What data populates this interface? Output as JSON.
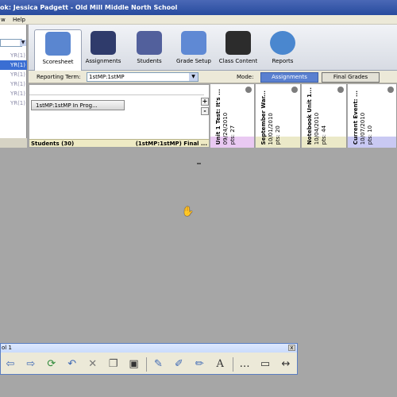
{
  "window": {
    "title": "ok: Jessica Padgett - Old Mill Middle North School"
  },
  "menu": [
    "w",
    "Help"
  ],
  "left_panel": {
    "rows": [
      "YR(1)",
      "YR(1)",
      "YR(1)",
      "YR(1)",
      "YR(1)",
      "YR(1)"
    ],
    "selected_index": 1
  },
  "ribbon_tabs": [
    {
      "label": "Scoresheet",
      "icon": "scoresheet-icon",
      "color": "#5a86d0",
      "active": true
    },
    {
      "label": "Assignments",
      "icon": "assignments-icon",
      "color": "#2f3b6b",
      "active": false
    },
    {
      "label": "Students",
      "icon": "students-icon",
      "color": "#52609c",
      "active": false
    },
    {
      "label": "Grade Setup",
      "icon": "grade-setup-icon",
      "color": "#5f89d4",
      "active": false
    },
    {
      "label": "Class Content",
      "icon": "class-content-icon",
      "color": "#2c2c2c",
      "active": false
    },
    {
      "label": "Reports",
      "icon": "reports-icon",
      "color": "#4a87cf",
      "active": false
    }
  ],
  "toolbar": {
    "reporting_term_label": "Reporting Term:",
    "reporting_term_value": "1stMP:1stMP",
    "mode_label": "Mode:",
    "mode_assignments": "Assignments",
    "mode_final_grades": "Final Grades"
  },
  "student_panel": {
    "group_button": "1stMP:1stMP In Prog...",
    "plus": "+",
    "minus": "-",
    "footer_left": "Students (30)",
    "footer_right": "(1stMP:1stMP) Final ..."
  },
  "assignments": [
    {
      "title": "Unit 1 Test: It's ...",
      "date": "09/24/2010",
      "pts": "pts: 27",
      "color": "#e9c9f2"
    },
    {
      "title": "September War...",
      "date": "10/01/2010",
      "pts": "pts: 20",
      "color": "#ebe9c8"
    },
    {
      "title": "Notebook Unit 1...",
      "date": "10/04/2010",
      "pts": "pts: 44",
      "color": "#ebe9c8"
    },
    {
      "title": "Current Event: ...",
      "date": "10/07/2010",
      "pts": "pts: 10",
      "color": "#c9c9f3"
    }
  ],
  "float_toolbar": {
    "title": "ol 1",
    "close": "x",
    "tools": [
      "back-arrow-icon",
      "forward-arrow-icon",
      "refresh-icon",
      "undo-icon",
      "delete-icon",
      "copy-icon",
      "image-icon",
      "pen-icon",
      "marker-icon",
      "highlighter-icon",
      "text-icon",
      "more-icon",
      "monitor-icon",
      "resize-icon"
    ]
  }
}
